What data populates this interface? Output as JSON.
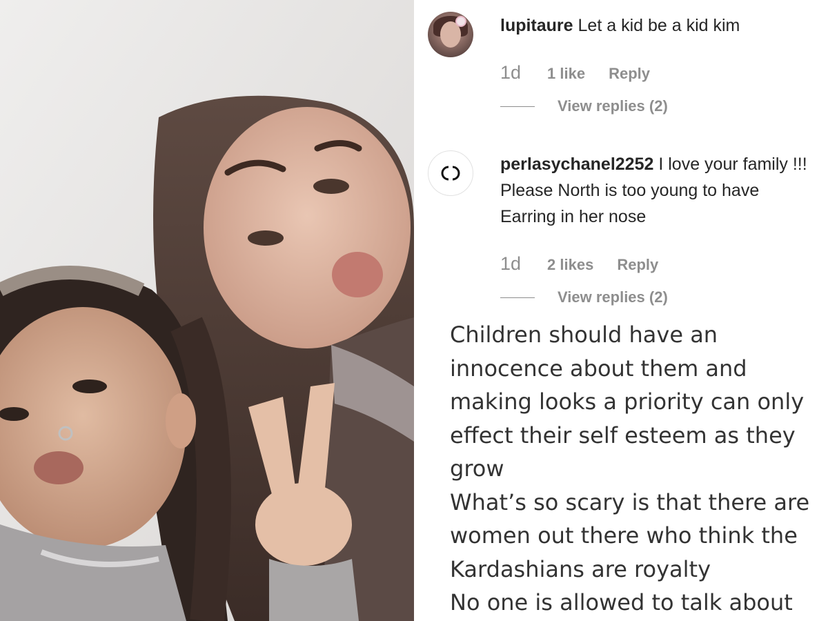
{
  "comments": [
    {
      "username": "lupitaure",
      "text": "Let a kid be a kid kim",
      "time": "1d",
      "likes": "1 like",
      "reply_label": "Reply",
      "view_replies": "View replies (2)"
    },
    {
      "username": "perlasychanel2252",
      "text": "I love your family !!! Please North is too young to have Earring in her nose",
      "time": "1d",
      "likes": "2 likes",
      "reply_label": "Reply",
      "view_replies": "View replies (2)"
    }
  ],
  "extended_comment": {
    "paragraphs": [
      "Children should have an innocence about them and making looks a priority can only effect their self esteem as they grow",
      "What’s so scary is that there are women out there who think the Kardashians are royalty",
      "No one is allowed to talk about"
    ]
  },
  "colors": {
    "text_primary": "#262626",
    "text_secondary": "#8e8e8e",
    "background": "#ffffff"
  },
  "icons": {
    "avatar_2": "chanel-logo-icon"
  }
}
